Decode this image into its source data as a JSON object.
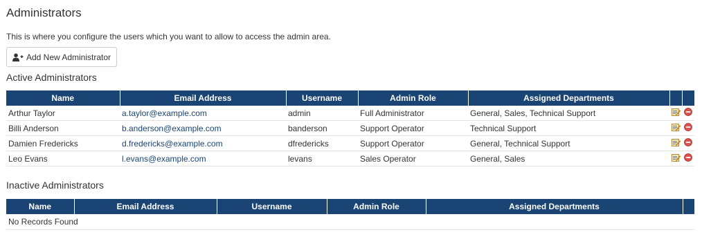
{
  "page": {
    "title": "Administrators",
    "intro": "This is where you configure the users which you want to allow to access the admin area.",
    "add_button_label": "Add New Administrator"
  },
  "active": {
    "title": "Active Administrators",
    "columns": [
      "Name",
      "Email Address",
      "Username",
      "Admin Role",
      "Assigned Departments",
      "",
      ""
    ],
    "rows": [
      {
        "name": "Arthur Taylor",
        "email": "a.taylor@example.com",
        "username": "admin",
        "role": "Full Administrator",
        "departments": "General, Sales, Technical Support",
        "edit_icon": "edit-icon",
        "delete_icon": "delete-icon"
      },
      {
        "name": "Billi Anderson",
        "email": "b.anderson@example.com",
        "username": "banderson",
        "role": "Support Operator",
        "departments": "Technical Support",
        "edit_icon": "edit-icon",
        "delete_icon": "delete-icon"
      },
      {
        "name": "Damien Fredericks",
        "email": "d.fredericks@example.com",
        "username": "dfredericks",
        "role": "Support Operator",
        "departments": "General, Technical Support",
        "edit_icon": "edit-icon",
        "delete_icon": "delete-icon"
      },
      {
        "name": "Leo Evans",
        "email": "l.evans@example.com",
        "username": "levans",
        "role": "Sales Operator",
        "departments": "General, Sales",
        "edit_icon": "edit-icon",
        "delete_icon": "delete-icon"
      }
    ]
  },
  "inactive": {
    "title": "Inactive Administrators",
    "columns": [
      "Name",
      "Email Address",
      "Username",
      "Admin Role",
      "Assigned Departments",
      ""
    ],
    "empty_text": "No Records Found"
  },
  "colors": {
    "header_bg": "#1a4473",
    "link": "#1a4473",
    "delete_red": "#d9534f"
  }
}
